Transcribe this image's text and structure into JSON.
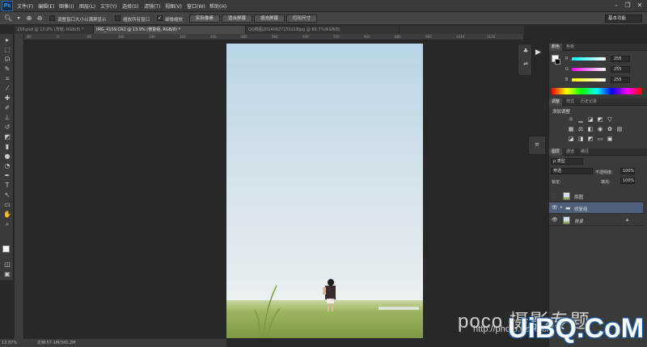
{
  "app": {
    "logo": "Ps"
  },
  "menu": [
    "文件(F)",
    "编辑(E)",
    "图像(I)",
    "图层(L)",
    "文字(Y)",
    "选择(S)",
    "滤镜(T)",
    "视图(V)",
    "窗口(W)",
    "帮助(H)"
  ],
  "window_controls": {
    "minimize": "–",
    "restore": "❐",
    "close": "✕"
  },
  "options": {
    "chk1_label": "调整窗口大小以满屏显示",
    "chk2_label": "缩放所有窗口",
    "chk3_label": "细微缩放",
    "btn_actual": "实际像素",
    "btn_fit": "适合屏幕",
    "btn_fill": "填充屏幕",
    "btn_print": "打印尺寸",
    "workspace": "基本功能"
  },
  "tabs": [
    "159.psd @ 13.9% (背景, RGB/8) *",
    "IMG_4159.CR2 @ 13.9% (修复组, RGB/8) *",
    "QQ截图20140827150216jpg @ 66.7%(RGB/8)"
  ],
  "ruler_ticks": [
    "-80",
    "0",
    "80",
    "160",
    "240",
    "320",
    "400",
    "480",
    "560",
    "640",
    "720",
    "800",
    "880",
    "960",
    "1040",
    "1120"
  ],
  "status": {
    "zoom": "13.87%",
    "doc": "文档:57.1M/345.2M"
  },
  "color_panel": {
    "tabs": [
      "颜色",
      "色板"
    ],
    "r_label": "R",
    "r_value": "255",
    "g_label": "G",
    "g_value": "255",
    "b_label": "B",
    "b_value": "255"
  },
  "adjust_panel": {
    "tabs": [
      "调整",
      "样式",
      "历史记录"
    ],
    "title": "添加调整"
  },
  "layers_panel": {
    "tabs": [
      "图层",
      "通道",
      "路径"
    ],
    "filter": "ρ 类型",
    "blend_mode": "穿透",
    "opacity_label": "不透明度:",
    "opacity": "100%",
    "lock_label": "锁定:",
    "fill_label": "填充:",
    "fill": "100%",
    "layers": [
      {
        "name": "原图",
        "visible": false
      },
      {
        "name": "修复组",
        "visible": true
      },
      {
        "name": "背景",
        "visible": true
      }
    ]
  },
  "watermark": {
    "poco": "poco 摄影专题",
    "url": "http://photo.poco.cn/",
    "uibq": "UiBQ.CoM"
  },
  "colors": {
    "canvas_sky": "#b8d4e6",
    "grass": "#8fae55",
    "selected_layer": "#4d5f7a"
  }
}
